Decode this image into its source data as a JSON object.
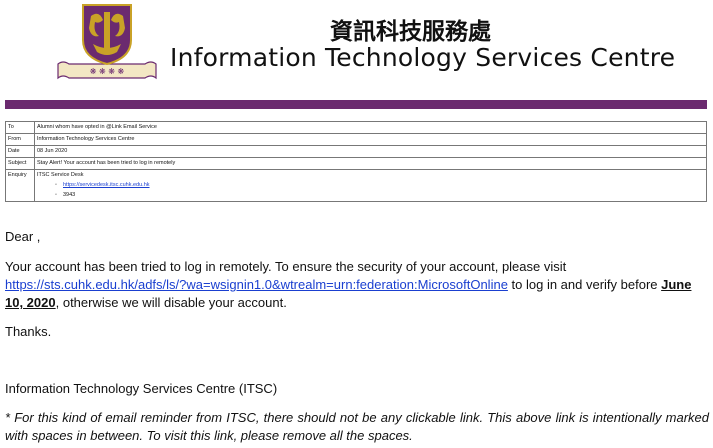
{
  "header": {
    "title_zh": "資訊科技服務處",
    "title_en": "Information Technology Services Centre"
  },
  "colors": {
    "bar": "#6b2a6f",
    "link": "#1a3fd0",
    "logo_gold": "#c9a227",
    "logo_purple": "#6b2a6f"
  },
  "meta": {
    "to_label": "To",
    "to_value": "Alumni whom have opted in @Link Email Service",
    "from_label": "From",
    "from_value": "Information Technology Services Centre",
    "date_label": "Date",
    "date_value": "08 Jun 2020",
    "subject_label": "Subject",
    "subject_value": "Stay Alert! Your account has been tried to log in remotely",
    "enquiry_label": "Enquiry",
    "enquiry_title": "ITSC Service Desk",
    "enquiry_link": "https://servicedesk.itsc.cuhk.edu.hk",
    "enquiry_phone": "3943"
  },
  "body": {
    "greeting": "Dear ,",
    "para1_a": "Your account has been tried to log in remotely. To ensure the security of your account, please visit ",
    "para1_link": "https://sts.cuhk.edu.hk/adfs/ls/?wa=wsignin1.0&wtrealm=urn:federation:MicrosoftOnline",
    "para1_b": " to log in and verify before ",
    "para1_date": "June 10, 2020",
    "para1_c": ", otherwise we will disable your account.",
    "thanks": "Thanks.",
    "signature": "Information Technology Services Centre (ITSC)",
    "note": "* For this kind of email reminder from ITSC, there should not be any clickable link. This above link is intentionally marked with spaces in between. To visit this link, please remove all the spaces."
  }
}
